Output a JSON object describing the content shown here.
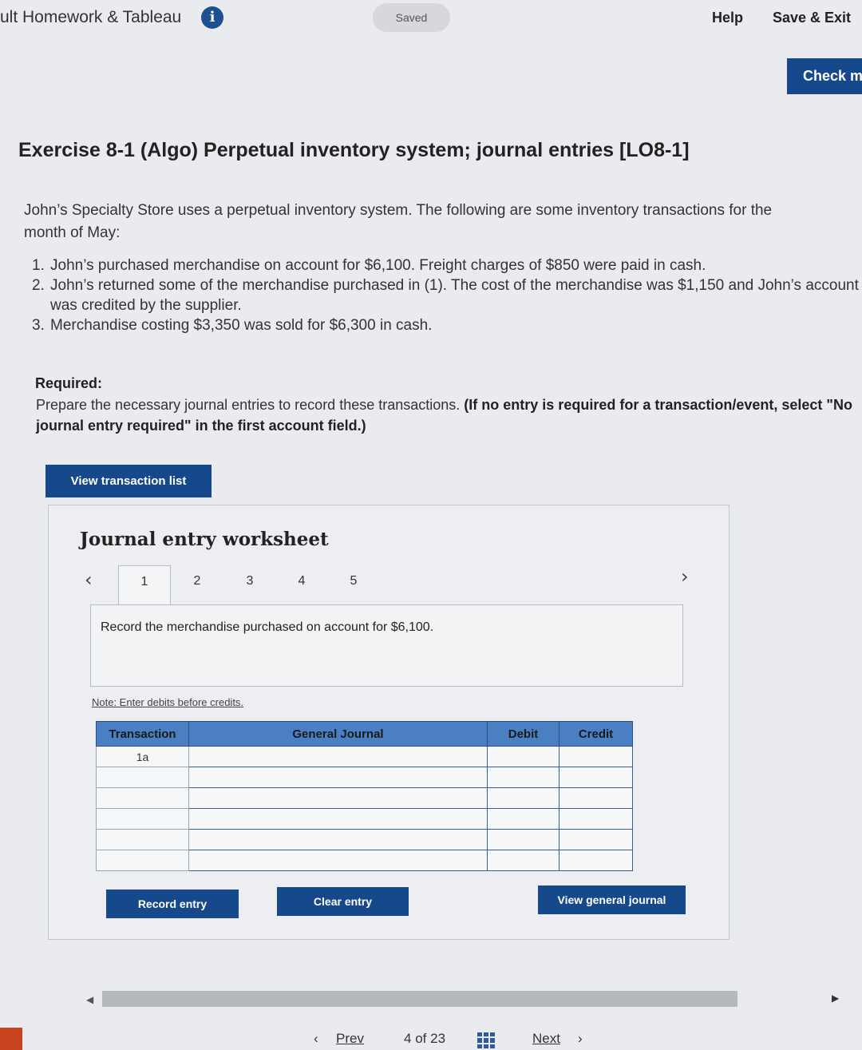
{
  "header": {
    "app_title": "ult Homework & Tableau",
    "saved_label": "Saved",
    "help_label": "Help",
    "save_exit_label": "Save & Exit",
    "check_label": "Check m"
  },
  "exercise": {
    "title": "Exercise 8-1 (Algo) Perpetual inventory system; journal entries [LO8-1]",
    "intro_line1": "John’s Specialty Store uses a perpetual inventory system. The following are some inventory transactions for the",
    "intro_line2": "month of May:",
    "transactions": [
      {
        "num": "1.",
        "text": "John’s purchased merchandise on account for $6,100. Freight charges of $850 were paid in cash."
      },
      {
        "num": "2.",
        "text": "John’s returned some of the merchandise purchased in (1). The cost of the merchandise was $1,150 and John’s account was credited by the supplier."
      },
      {
        "num": "3.",
        "text": "Merchandise costing $3,350 was sold for $6,300 in cash."
      }
    ],
    "required_label": "Required:",
    "required_text": "Prepare the necessary journal entries to record these transactions. ",
    "required_bold": "(If no entry is required for a transaction/event, select \"No journal entry required\" in the first account field.)"
  },
  "buttons": {
    "view_transactions": "View transaction list",
    "record_entry": "Record entry",
    "clear_entry": "Clear entry",
    "view_general_journal": "View general journal"
  },
  "worksheet": {
    "title": "Journal entry worksheet",
    "tabs": [
      "1",
      "2",
      "3",
      "4",
      "5"
    ],
    "active_tab": 0,
    "prompt": "Record the merchandise purchased on account for $6,100.",
    "note": "Note: Enter debits before credits.",
    "columns": [
      "Transaction",
      "General Journal",
      "Debit",
      "Credit"
    ],
    "rows": [
      "1a",
      "",
      "",
      "",
      "",
      ""
    ]
  },
  "footer": {
    "prev_label": "Prev",
    "page_current": "4",
    "page_of": "of",
    "page_total": "23",
    "next_label": "Next"
  },
  "colors": {
    "primary_button": "#16488c",
    "table_header": "#4a7fc3"
  }
}
